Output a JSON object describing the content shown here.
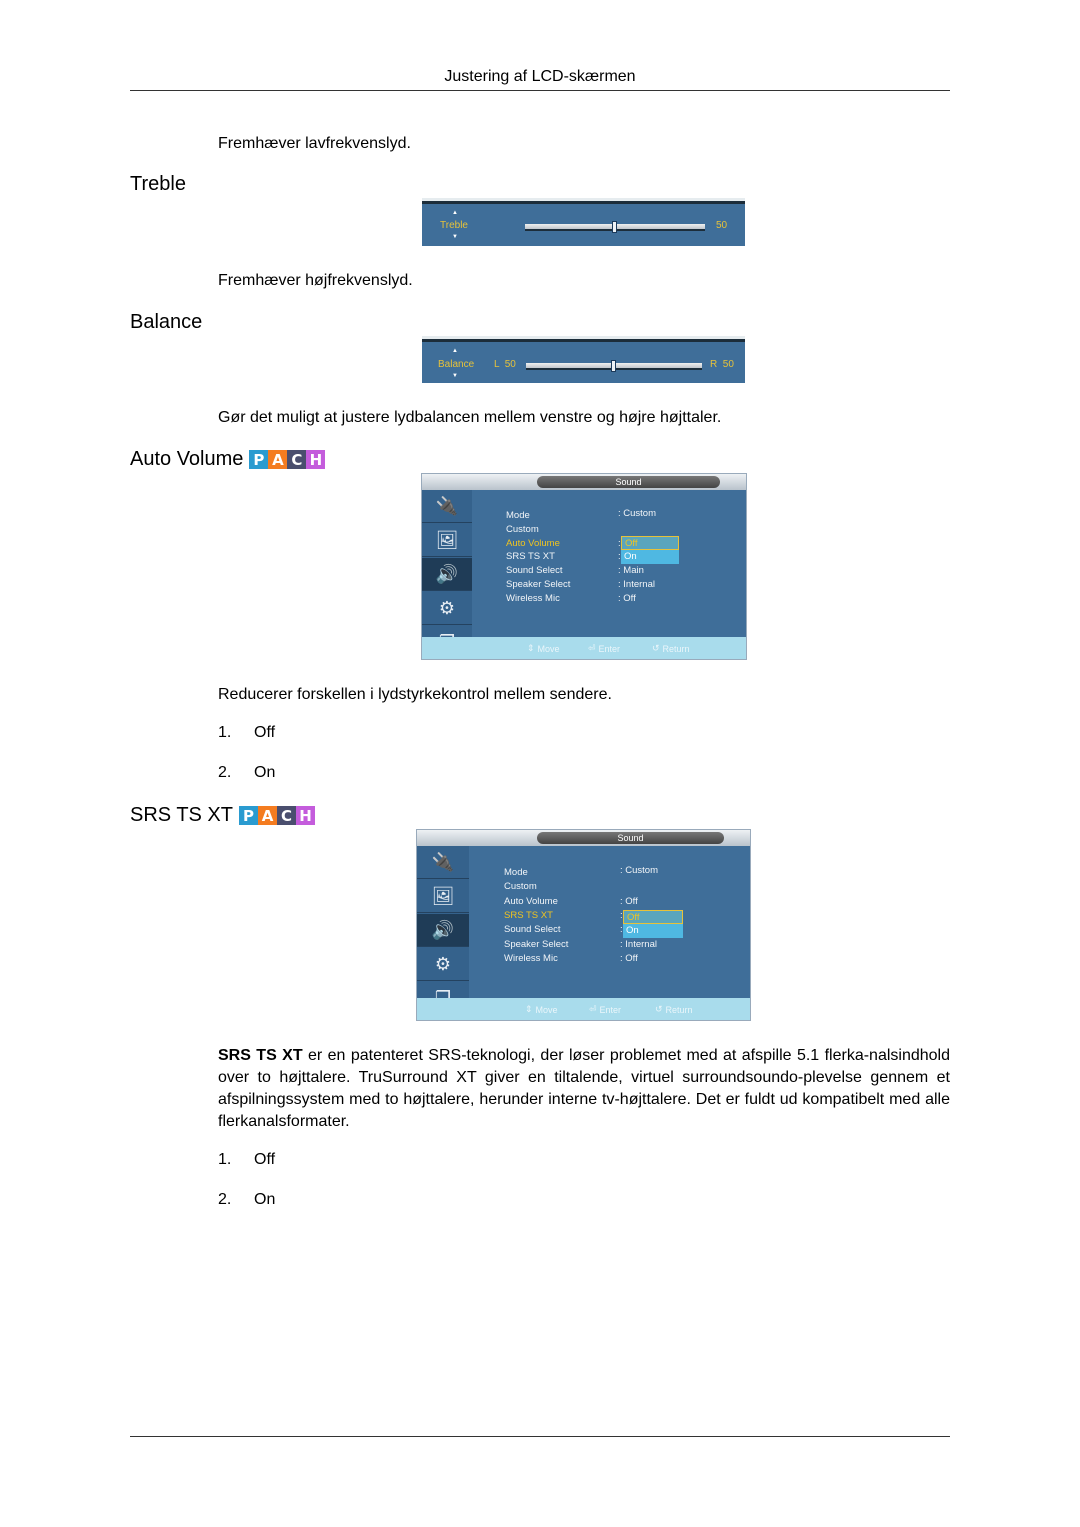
{
  "header": {
    "title": "Justering af LCD-skærmen"
  },
  "intro": {
    "bass_desc": "Fremhæver lavfrekvenslyd."
  },
  "treble": {
    "heading": "Treble",
    "osd": {
      "label": "Treble",
      "value": "50",
      "level_percent": 50
    },
    "desc": "Fremhæver højfrekvenslyd."
  },
  "balance": {
    "heading": "Balance",
    "osd": {
      "label": "Balance",
      "left": "L  50",
      "right": "R  50",
      "level_percent": 50
    },
    "desc": "Gør det muligt at justere lydbalancen mellem venstre og højre højttaler."
  },
  "pach_badge": {
    "letters": [
      "P",
      "A",
      "C",
      "H"
    ],
    "colors": [
      "#2a9bd0",
      "#f47c20",
      "#4a4e6e",
      "#c45cdc"
    ]
  },
  "auto_volume": {
    "heading": "Auto Volume",
    "desc": "Reducerer forskellen i lydstyrkekontrol mellem sendere.",
    "options": [
      {
        "num": "1.",
        "label": "Off"
      },
      {
        "num": "2.",
        "label": "On"
      }
    ],
    "osd": {
      "title": "Sound",
      "rows": [
        {
          "label": "Mode",
          "value": ": Custom"
        },
        {
          "label": "Custom",
          "value": ""
        },
        {
          "label": "Auto Volume",
          "value": ":"
        },
        {
          "label": "SRS TS XT",
          "value": ":"
        },
        {
          "label": "Sound Select",
          "value": ": Main"
        },
        {
          "label": "Speaker Select",
          "value": ": Internal"
        },
        {
          "label": "Wireless Mic",
          "value": ": Off"
        }
      ],
      "highlighted_row": "Auto Volume",
      "dropdown": [
        "Off",
        "On"
      ],
      "hints": {
        "move": "Move",
        "enter": "Enter",
        "return": "Return"
      }
    }
  },
  "srs": {
    "heading": "SRS TS XT",
    "desc_bold": "SRS TS XT",
    "desc": " er en patenteret SRS-teknologi, der løser problemet med at afspille 5.1 flerka-nalsindhold over to højttalere. TruSurround XT giver en tiltalende, virtuel surroundsoundo-plevelse gennem et afspilningssystem med to højttalere, herunder interne tv-højttalere. Det er fuldt ud kompatibelt med alle flerkanalsformater.",
    "options": [
      {
        "num": "1.",
        "label": "Off"
      },
      {
        "num": "2.",
        "label": "On"
      }
    ],
    "osd": {
      "title": "Sound",
      "rows": [
        {
          "label": "Mode",
          "value": ": Custom"
        },
        {
          "label": "Custom",
          "value": ""
        },
        {
          "label": "Auto Volume",
          "value": ": Off"
        },
        {
          "label": "SRS TS XT",
          "value": ":"
        },
        {
          "label": "Sound Select",
          "value": ":"
        },
        {
          "label": "Speaker Select",
          "value": ": Internal"
        },
        {
          "label": "Wireless Mic",
          "value": ": Off"
        }
      ],
      "highlighted_row": "SRS TS XT",
      "dropdown": [
        "Off",
        "On"
      ],
      "hints": {
        "move": "Move",
        "enter": "Enter",
        "return": "Return"
      }
    }
  }
}
